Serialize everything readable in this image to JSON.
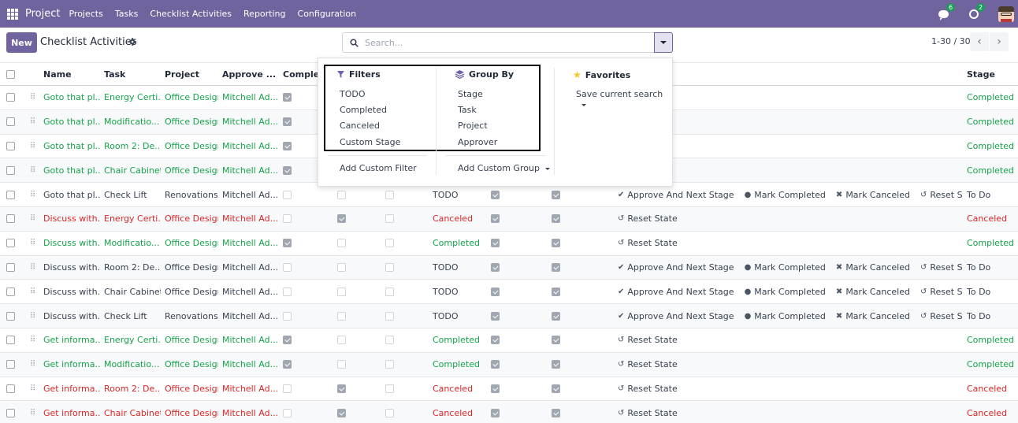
{
  "navbar": {
    "brand": "Project",
    "menu": [
      "Projects",
      "Tasks",
      "Checklist Activities",
      "Reporting",
      "Configuration"
    ],
    "messages_count": "6",
    "activities_count": "2"
  },
  "control": {
    "new_label": "New",
    "title": "Checklist Activities",
    "search_placeholder": "Search...",
    "pager": "1-30 / 30"
  },
  "columns": [
    "Name",
    "Task",
    "Project",
    "Approve ...",
    "Complete",
    "Stage"
  ],
  "dropdown": {
    "filters_title": "Filters",
    "filters": [
      "TODO",
      "Completed",
      "Canceled",
      "Custom Stage"
    ],
    "add_filter": "Add Custom Filter",
    "groupby_title": "Group By",
    "groupby": [
      "Stage",
      "Task",
      "Project",
      "Approver"
    ],
    "add_group": "Add Custom Group",
    "favorites_title": "Favorites",
    "save_search": "Save current search"
  },
  "actions": {
    "approve": "Approve And Next Stage",
    "mark_completed": "Mark Completed",
    "mark_canceled": "Mark Canceled",
    "reset": "Reset State"
  },
  "colors": {
    "accent": "#71639e",
    "completed": "#16a34a",
    "canceled": "#dc2626"
  },
  "rows": [
    {
      "name": "Goto that pl...",
      "task": "Energy Certi...",
      "project": "Office Design",
      "approver": "Mitchell Ad...",
      "complete": true,
      "b1": false,
      "b2": false,
      "state": "",
      "b3": false,
      "b4": false,
      "actions": [],
      "stage": "Completed",
      "color": "green",
      "hidden": true
    },
    {
      "name": "Goto that pl...",
      "task": "Modificatio...",
      "project": "Office Design",
      "approver": "Mitchell Ad...",
      "complete": true,
      "b1": false,
      "b2": false,
      "state": "",
      "b3": false,
      "b4": false,
      "actions": [],
      "stage": "Completed",
      "color": "green",
      "hidden": true
    },
    {
      "name": "Goto that pl...",
      "task": "Room 2: De...",
      "project": "Office Design",
      "approver": "Mitchell Ad...",
      "complete": true,
      "b1": false,
      "b2": false,
      "state": "",
      "b3": false,
      "b4": false,
      "actions": [],
      "stage": "Completed",
      "color": "green",
      "hidden": true
    },
    {
      "name": "Goto that pl...",
      "task": "Chair Cabinet",
      "project": "Office Design",
      "approver": "Mitchell Ad...",
      "complete": true,
      "b1": false,
      "b2": false,
      "state": "",
      "b3": false,
      "b4": false,
      "actions": [],
      "stage": "Completed",
      "color": "green",
      "hidden": true
    },
    {
      "name": "Goto that pl...",
      "task": "Check Lift",
      "project": "Renovations",
      "approver": "Mitchell Ad...",
      "complete": false,
      "b1": false,
      "b2": false,
      "state": "TODO",
      "b3": true,
      "b4": true,
      "actions": [
        "approve",
        "mark_completed",
        "mark_canceled",
        "reset"
      ],
      "stage": "To Do",
      "color": "plain"
    },
    {
      "name": "Discuss with...",
      "task": "Energy Certi...",
      "project": "Office Design",
      "approver": "Mitchell Ad...",
      "complete": false,
      "b1": true,
      "b2": false,
      "state": "Canceled",
      "b3": true,
      "b4": true,
      "actions": [
        "reset"
      ],
      "stage": "Canceled",
      "color": "red"
    },
    {
      "name": "Discuss with...",
      "task": "Modificatio...",
      "project": "Office Design",
      "approver": "Mitchell Ad...",
      "complete": true,
      "b1": false,
      "b2": false,
      "state": "Completed",
      "b3": true,
      "b4": true,
      "actions": [
        "reset"
      ],
      "stage": "Completed",
      "color": "green"
    },
    {
      "name": "Discuss with...",
      "task": "Room 2: De...",
      "project": "Office Design",
      "approver": "Mitchell Ad...",
      "complete": false,
      "b1": false,
      "b2": false,
      "state": "TODO",
      "b3": true,
      "b4": true,
      "actions": [
        "approve",
        "mark_completed",
        "mark_canceled",
        "reset"
      ],
      "stage": "To Do",
      "color": "plain"
    },
    {
      "name": "Discuss with...",
      "task": "Chair Cabinet",
      "project": "Office Design",
      "approver": "Mitchell Ad...",
      "complete": false,
      "b1": false,
      "b2": false,
      "state": "TODO",
      "b3": true,
      "b4": true,
      "actions": [
        "approve",
        "mark_completed",
        "mark_canceled",
        "reset"
      ],
      "stage": "To Do",
      "color": "plain"
    },
    {
      "name": "Discuss with...",
      "task": "Check Lift",
      "project": "Renovations",
      "approver": "Mitchell Ad...",
      "complete": false,
      "b1": false,
      "b2": false,
      "state": "TODO",
      "b3": true,
      "b4": true,
      "actions": [
        "approve",
        "mark_completed",
        "mark_canceled",
        "reset"
      ],
      "stage": "To Do",
      "color": "plain"
    },
    {
      "name": "Get informa...",
      "task": "Energy Certi...",
      "project": "Office Design",
      "approver": "Mitchell Ad...",
      "complete": true,
      "b1": false,
      "b2": false,
      "state": "Completed",
      "b3": true,
      "b4": true,
      "actions": [
        "reset"
      ],
      "stage": "Completed",
      "color": "green"
    },
    {
      "name": "Get informa...",
      "task": "Modificatio...",
      "project": "Office Design",
      "approver": "Mitchell Ad...",
      "complete": true,
      "b1": false,
      "b2": false,
      "state": "Completed",
      "b3": true,
      "b4": true,
      "actions": [
        "reset"
      ],
      "stage": "Completed",
      "color": "green"
    },
    {
      "name": "Get informa...",
      "task": "Room 2: De...",
      "project": "Office Design",
      "approver": "Mitchell Ad...",
      "complete": false,
      "b1": true,
      "b2": false,
      "state": "Canceled",
      "b3": true,
      "b4": true,
      "actions": [
        "reset"
      ],
      "stage": "Canceled",
      "color": "red"
    },
    {
      "name": "Get informa...",
      "task": "Chair Cabinet",
      "project": "Office Design",
      "approver": "Mitchell Ad...",
      "complete": false,
      "b1": true,
      "b2": false,
      "state": "Canceled",
      "b3": true,
      "b4": true,
      "actions": [
        "reset"
      ],
      "stage": "Canceled",
      "color": "red"
    }
  ]
}
